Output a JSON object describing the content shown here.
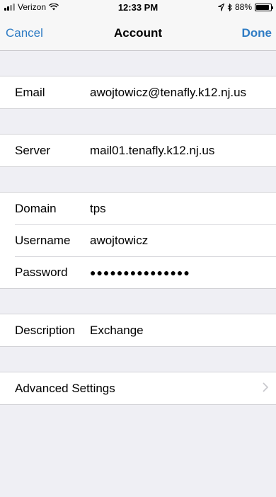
{
  "status": {
    "carrier": "Verizon",
    "time": "12:33 PM",
    "battery": "88%",
    "battery_level": 0.88
  },
  "nav": {
    "cancel": "Cancel",
    "title": "Account",
    "done": "Done"
  },
  "fields": {
    "email": {
      "label": "Email",
      "value": "awojtowicz@tenafly.k12.nj.us"
    },
    "server": {
      "label": "Server",
      "value": "mail01.tenafly.k12.nj.us"
    },
    "domain": {
      "label": "Domain",
      "value": "tps"
    },
    "username": {
      "label": "Username",
      "value": "awojtowicz"
    },
    "password": {
      "label": "Password",
      "value": "●●●●●●●●●●●●●●●"
    },
    "description": {
      "label": "Description",
      "value": "Exchange"
    }
  },
  "advanced": {
    "label": "Advanced Settings"
  },
  "colors": {
    "accent": "#2f7cc4",
    "background": "#efeff4"
  }
}
